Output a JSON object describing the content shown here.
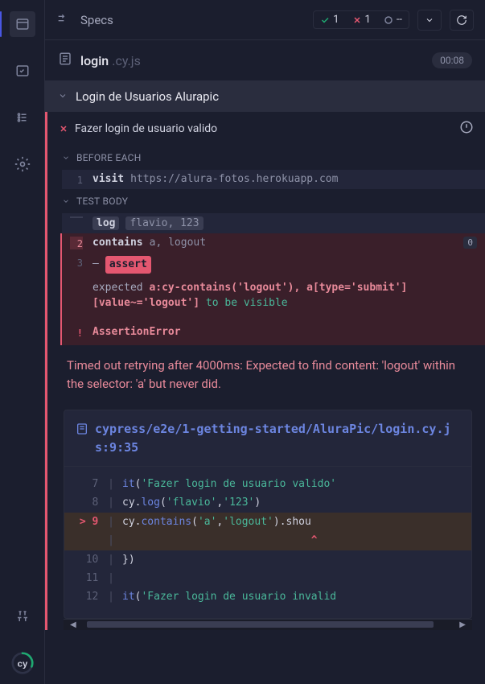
{
  "header": {
    "specs_label": "Specs",
    "pass_count": "1",
    "fail_count": "1",
    "pending_count": "--"
  },
  "spec": {
    "name": "login",
    "ext": ".cy.js",
    "duration": "00:08"
  },
  "suite": {
    "name": "Login de Usuarios Alurapic"
  },
  "test": {
    "name": "Fazer login de usuario valido"
  },
  "sections": {
    "before_each": "BEFORE EACH",
    "test_body": "TEST BODY"
  },
  "cmds": {
    "n1": "1",
    "c1": "visit",
    "a1": "https://alura-fotos.herokuapp.com",
    "n2": " ",
    "c2": "log",
    "a2": "flavio, 123",
    "n3": "2",
    "c3": "contains",
    "a3": "a, logout",
    "pin": "0",
    "n4": "3",
    "dash": "–",
    "c4": "assert",
    "a4a": "expected ",
    "a4b": "a:cy-contains('logout'), a[type='submit'][value~='logout']",
    "a4c": " to be visible",
    "bang": "!",
    "aerr": "AssertionError"
  },
  "error_msg": "Timed out retrying after 4000ms: Expected to find content: 'logout' within the selector: 'a' but never did.",
  "file_ref": "cypress/e2e/1-getting-started/AluraPic/login.cy.js:9:35",
  "code": {
    "l7g": " 7 ",
    "l7a": "it",
    "l7b": "(",
    "l7c": "'Fazer login de usuario valido'",
    "l8g": " 8 ",
    "l8a": "cy.",
    "l8b": "log",
    "l8c": "(",
    "l8d": "'flavio'",
    "l8e": ",",
    "l8f": "'123'",
    "l8h": ")",
    "l9g": "> 9 ",
    "l9a": "cy.",
    "l9b": "contains",
    "l9c": "(",
    "l9d": "'a'",
    "l9e": ",",
    "l9f": "'logout'",
    "l9h": ").shou",
    "caret_g": "   ",
    "caret": "                              ^",
    "l10g": "10 ",
    "l10a": "})",
    "l11g": "11 ",
    "l12g": "12 ",
    "l12a": "it",
    "l12b": "(",
    "l12c": "'Fazer login de usuario invalid"
  }
}
